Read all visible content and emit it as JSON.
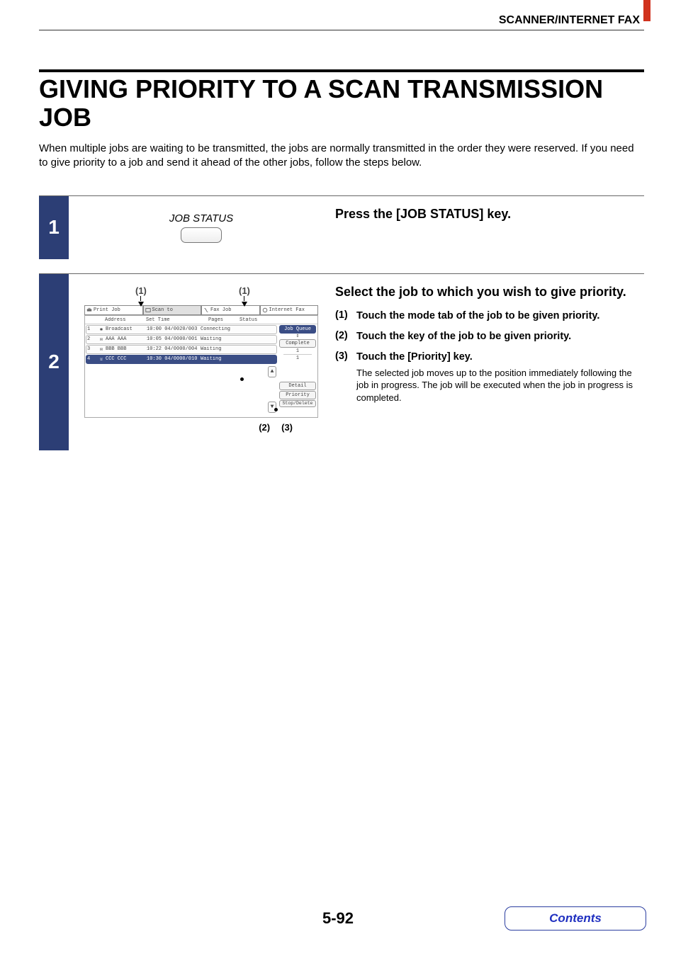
{
  "header": {
    "section": "SCANNER/INTERNET FAX"
  },
  "title": "GIVING PRIORITY TO A SCAN TRANSMISSION JOB",
  "intro": "When multiple jobs are waiting to be transmitted, the jobs are normally transmitted in the order they were reserved. If you need to give priority to a job and send it ahead of the other jobs, follow the steps below.",
  "step1": {
    "num": "1",
    "graphic_label": "JOB STATUS",
    "heading": "Press the [JOB STATUS] key."
  },
  "step2": {
    "num": "2",
    "heading": "Select the job to which you wish to give priority.",
    "items": [
      {
        "n": "(1)",
        "t": "Touch the mode tab of the job to be given priority."
      },
      {
        "n": "(2)",
        "t": "Touch the key of the job to be given priority."
      },
      {
        "n": "(3)",
        "t": "Touch the [Priority] key."
      }
    ],
    "body": "The selected job moves up to the position immediately following the job in progress. The job will be executed when the job in progress is completed.",
    "callouts": {
      "c1": "(1)",
      "c2": "(1)",
      "c3": "(2)",
      "c4": "(3)"
    },
    "screen": {
      "tabs": [
        "Print Job",
        "Scan to",
        "Fax Job",
        "Internet Fax"
      ],
      "columns": [
        "",
        "",
        "Address",
        "Set Time",
        "Pages",
        "Status"
      ],
      "rows": [
        {
          "n": "1",
          "icon": "broadcast",
          "addr": "Broadcast",
          "time": "10:00 04/01",
          "pages": "020/003",
          "status": "Connecting"
        },
        {
          "n": "2",
          "icon": "mail",
          "addr": "AAA AAA",
          "time": "10:05 04/01",
          "pages": "000/001",
          "status": "Waiting"
        },
        {
          "n": "3",
          "icon": "mail",
          "addr": "BBB BBB",
          "time": "10:22 04/01",
          "pages": "000/004",
          "status": "Waiting"
        },
        {
          "n": "4",
          "icon": "fax",
          "addr": "CCC CCC",
          "time": "10:30 04/01",
          "pages": "000/010",
          "status": "Waiting",
          "selected": true
        }
      ],
      "side": {
        "jobqueue": "Job Queue",
        "complete": "Complete",
        "progress": "1",
        "total": "1",
        "detail": "Detail",
        "priority": "Priority",
        "stopdelete": "Stop/Delete"
      }
    }
  },
  "footer": {
    "pagenum": "5-92",
    "contents": "Contents"
  }
}
